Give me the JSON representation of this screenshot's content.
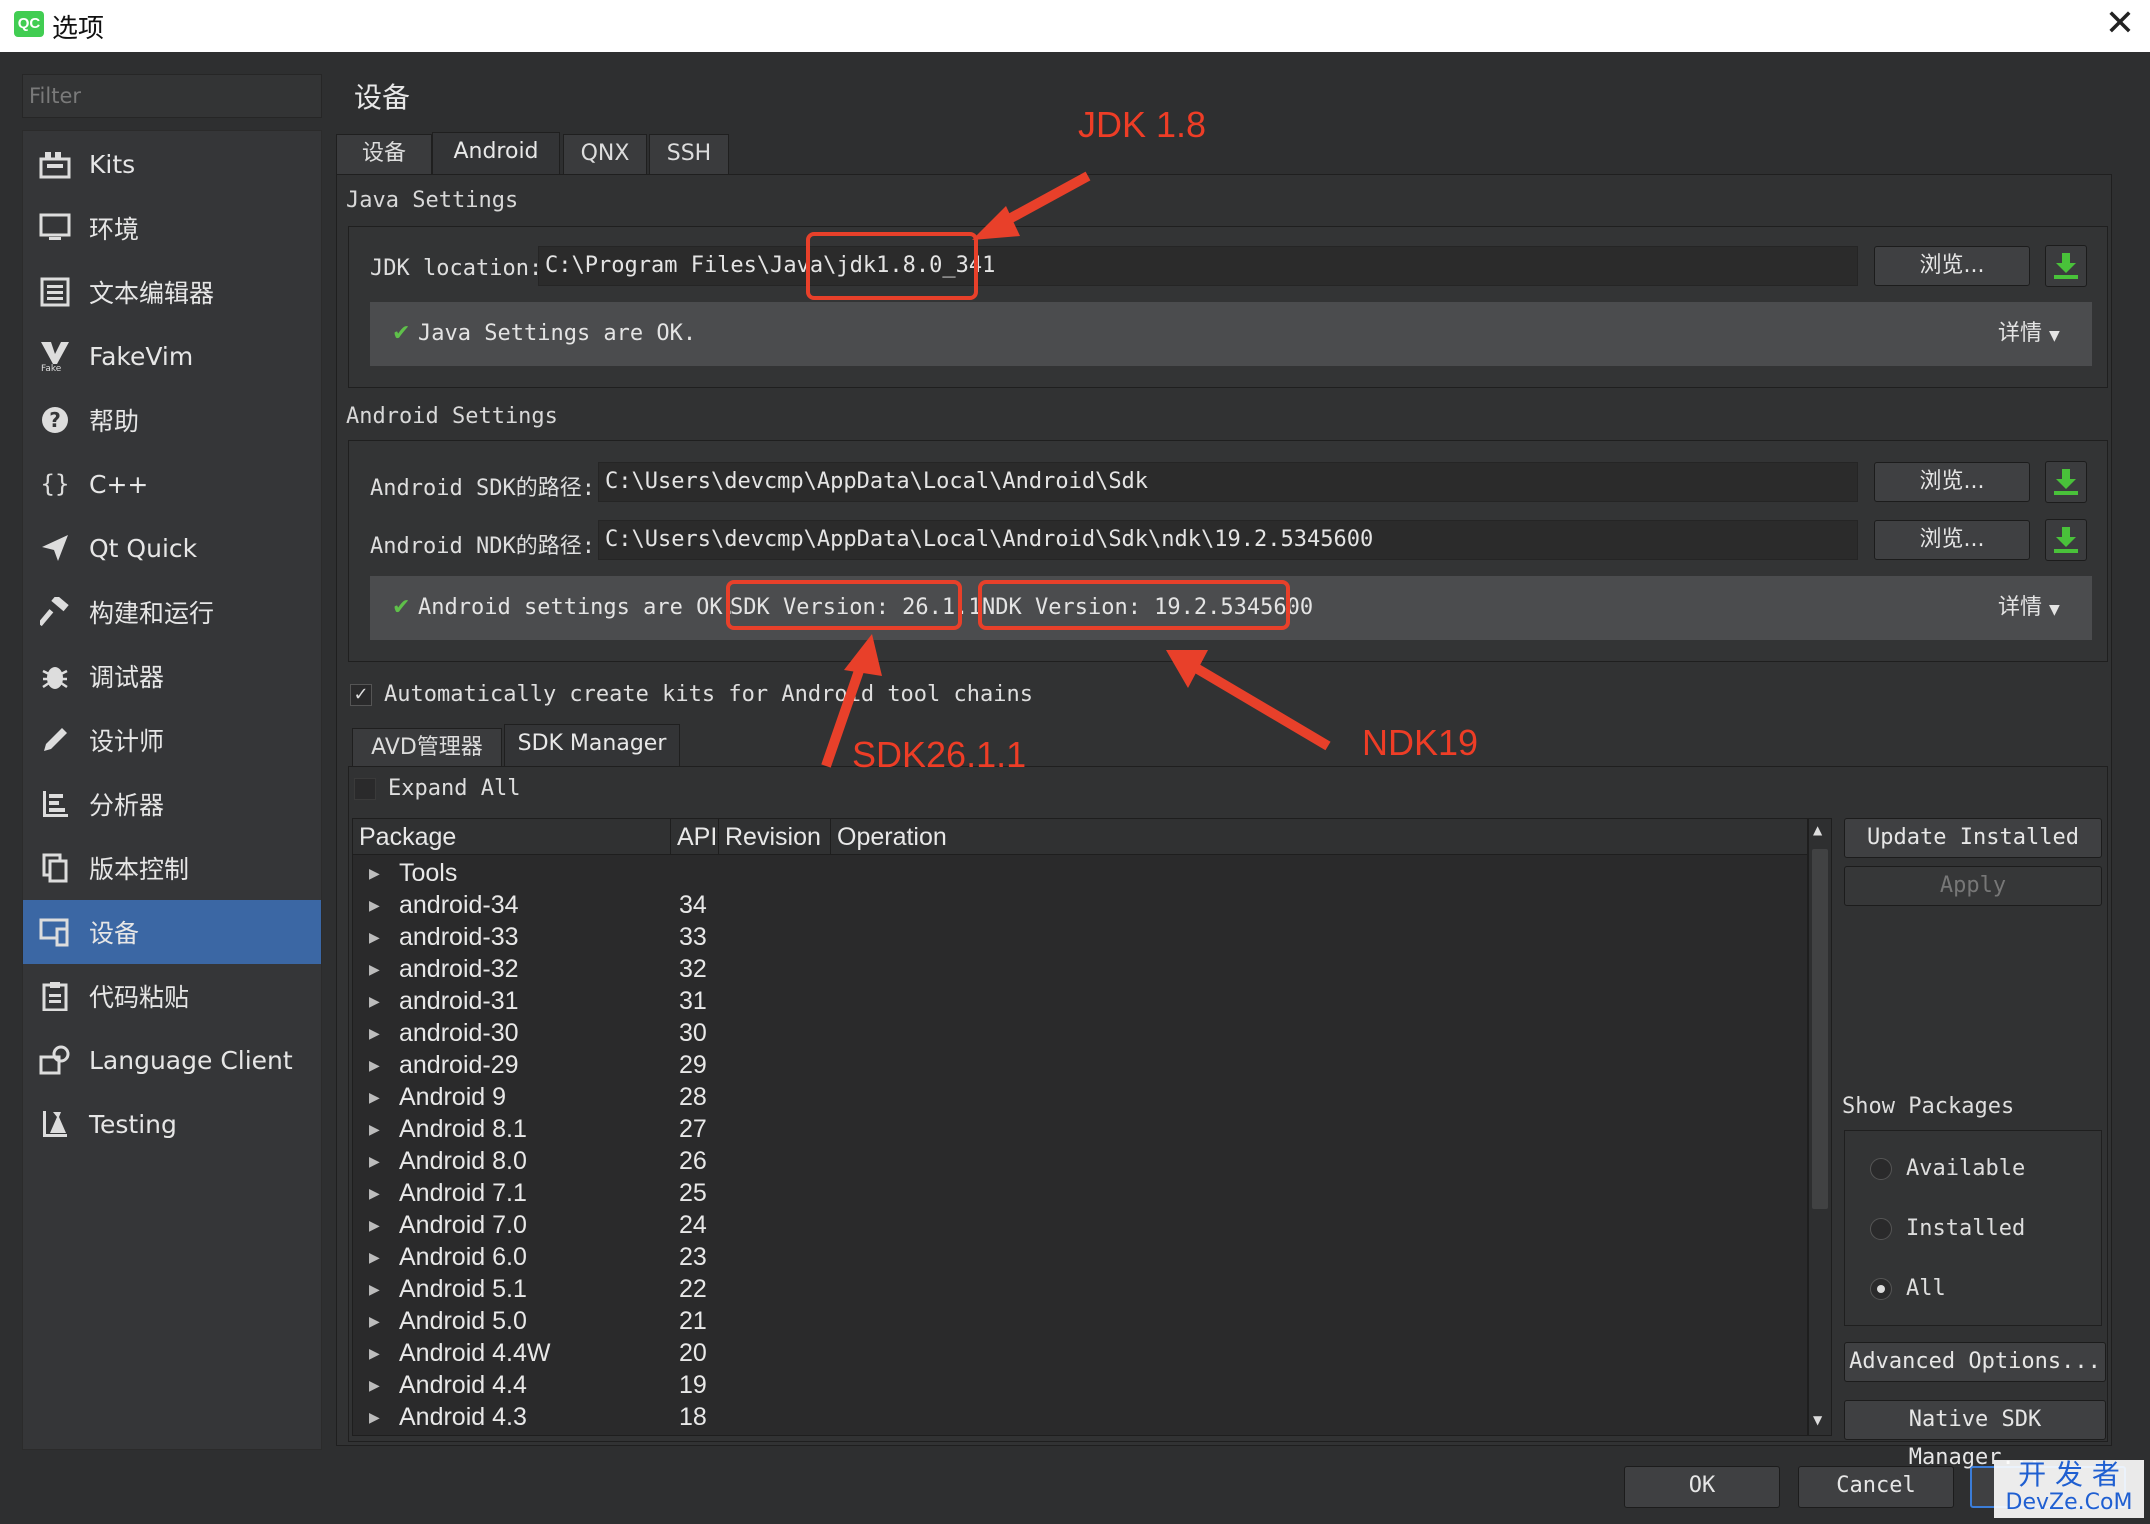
{
  "window": {
    "title": "选项",
    "logo_text": "QC",
    "close_glyph": "✕"
  },
  "filter": {
    "placeholder": "Filter"
  },
  "nav": {
    "items": [
      {
        "label": "Kits",
        "icon": "kits-icon"
      },
      {
        "label": "环境",
        "icon": "monitor-icon"
      },
      {
        "label": "文本编辑器",
        "icon": "text-editor-icon"
      },
      {
        "label": "FakeVim",
        "icon": "fakevim-icon"
      },
      {
        "label": "帮助",
        "icon": "help-icon"
      },
      {
        "label": "C++",
        "icon": "braces-icon"
      },
      {
        "label": "Qt Quick",
        "icon": "qtquick-icon"
      },
      {
        "label": "构建和运行",
        "icon": "hammer-icon"
      },
      {
        "label": "调试器",
        "icon": "bug-icon"
      },
      {
        "label": "设计师",
        "icon": "pencil-icon"
      },
      {
        "label": "分析器",
        "icon": "analyzer-icon"
      },
      {
        "label": "版本控制",
        "icon": "version-control-icon"
      },
      {
        "label": "设备",
        "icon": "device-icon"
      },
      {
        "label": "代码粘贴",
        "icon": "clipboard-icon"
      },
      {
        "label": "Language Client",
        "icon": "language-client-icon"
      },
      {
        "label": "Testing",
        "icon": "testing-icon"
      }
    ],
    "selected": "设备"
  },
  "page": {
    "title": "设备",
    "tabs": [
      "设备",
      "Android",
      "QNX",
      "SSH"
    ],
    "active_tab": "Android"
  },
  "java": {
    "group_title": "Java Settings",
    "jdk_label": "JDK location:",
    "jdk_value": "C:\\Program Files\\Java\\jdk1.8.0_341",
    "browse": "浏览...",
    "status": "Java Settings are OK.",
    "details": "详情"
  },
  "android": {
    "group_title": "Android Settings",
    "sdk_label": "Android SDK的路径:",
    "sdk_value": "C:\\Users\\devcmp\\AppData\\Local\\Android\\Sdk",
    "ndk_label": "Android NDK的路径:",
    "ndk_value": "C:\\Users\\devcmp\\AppData\\Local\\Android\\Sdk\\ndk\\19.2.5345600",
    "browse": "浏览...",
    "status": "Android settings are OK.",
    "sdk_version": "SDK Version: 26.1.1",
    "ndk_version": "NDK Version: 19.2.5345600",
    "details": "详情",
    "auto_create": "Automatically create kits for Android tool chains",
    "auto_create_checked": true
  },
  "sdk_tabs": [
    "AVD管理器",
    "SDK Manager"
  ],
  "sdk_active_tab": "SDK Manager",
  "expand_all": "Expand All",
  "tree": {
    "columns": [
      "Package",
      "API",
      "Revision",
      "Operation"
    ],
    "rows": [
      {
        "package": "Tools",
        "api": ""
      },
      {
        "package": "android-34",
        "api": "34"
      },
      {
        "package": "android-33",
        "api": "33"
      },
      {
        "package": "android-32",
        "api": "32"
      },
      {
        "package": "android-31",
        "api": "31"
      },
      {
        "package": "android-30",
        "api": "30"
      },
      {
        "package": "android-29",
        "api": "29"
      },
      {
        "package": "Android 9",
        "api": "28"
      },
      {
        "package": "Android 8.1",
        "api": "27"
      },
      {
        "package": "Android 8.0",
        "api": "26"
      },
      {
        "package": "Android 7.1",
        "api": "25"
      },
      {
        "package": "Android 7.0",
        "api": "24"
      },
      {
        "package": "Android 6.0",
        "api": "23"
      },
      {
        "package": "Android 5.1",
        "api": "22"
      },
      {
        "package": "Android 5.0",
        "api": "21"
      },
      {
        "package": "Android 4.4W",
        "api": "20"
      },
      {
        "package": "Android 4.4",
        "api": "19"
      },
      {
        "package": "Android 4.3",
        "api": "18"
      }
    ]
  },
  "side": {
    "update_installed": "Update Installed",
    "apply": "Apply",
    "show_packages": "Show Packages",
    "options": [
      "Available",
      "Installed",
      "All"
    ],
    "selected_option": "All",
    "advanced": "Advanced Options...",
    "native": "Native SDK Manager..."
  },
  "footer": {
    "ok": "OK",
    "cancel": "Cancel"
  },
  "annotations": {
    "jdk": "JDK 1.8",
    "sdk": "SDK26.1.1",
    "ndk": "NDK19"
  },
  "watermark": {
    "line1": "开 发 者",
    "line2": "DevZe.CoM"
  },
  "colors": {
    "accent": "#3b67a4",
    "annotation": "#e8402a",
    "ok_green": "#4caf50"
  }
}
